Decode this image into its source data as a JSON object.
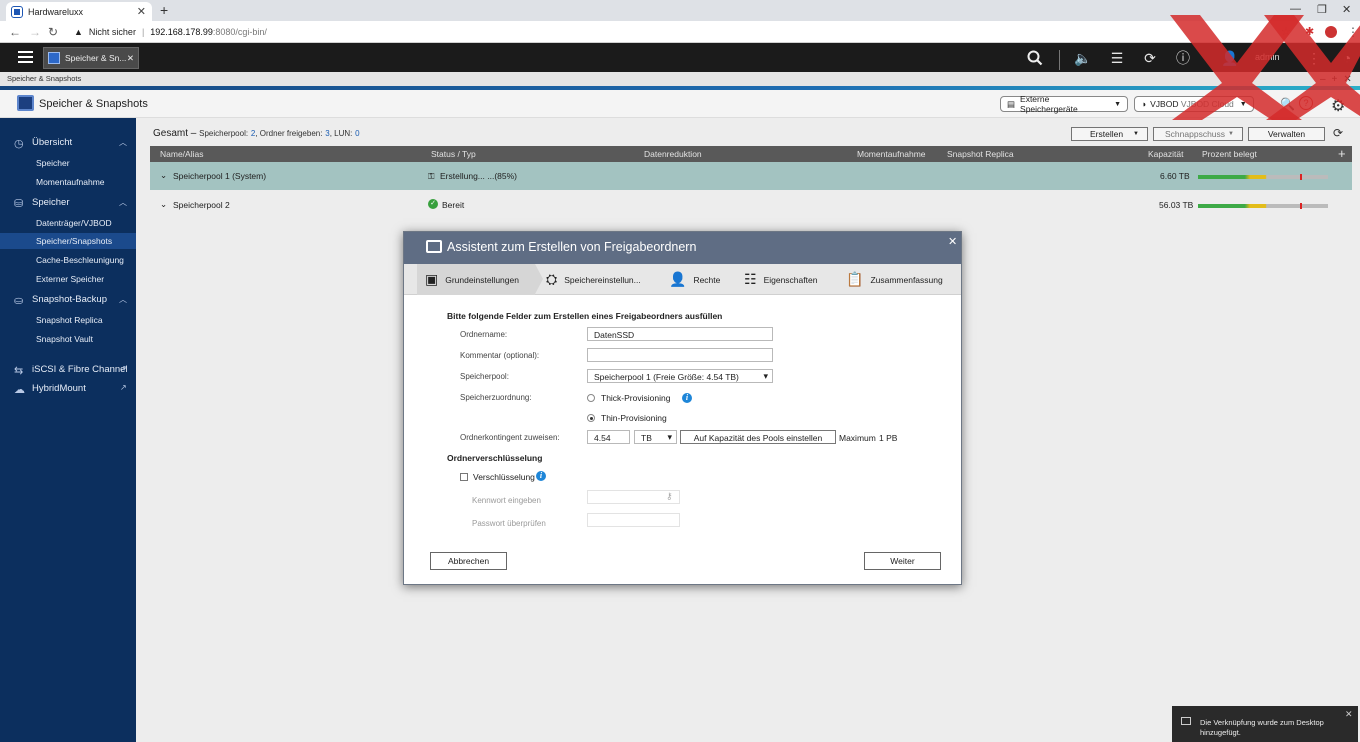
{
  "browser": {
    "tab_title": "Hardwareluxx",
    "security_label": "Nicht sicher",
    "url_host": "192.168.178.99",
    "url_path": ":8080/cgi-bin/"
  },
  "qts": {
    "app_tab": "Speicher & Sn...",
    "user": "admin",
    "strip_title": "Speicher & Snapshots"
  },
  "app": {
    "title": "Speicher & Snapshots",
    "btn_external": "Externe Speichergeräte",
    "btn_vjbod": "VJBOD",
    "btn_vjbod_cloud": "VJBOD Cloud"
  },
  "sidebar": {
    "overview": "Übersicht",
    "overview_items": [
      "Speicher",
      "Momentaufnahme"
    ],
    "storage": "Speicher",
    "storage_items": [
      "Datenträger/VJBOD",
      "Speicher/Snapshots",
      "Cache-Beschleunigung",
      "Externer Speicher"
    ],
    "snapshot_backup": "Snapshot-Backup",
    "snapshot_items": [
      "Snapshot Replica",
      "Snapshot Vault"
    ],
    "iscsi": "iSCSI & Fibre Channel",
    "hybridmount": "HybridMount"
  },
  "summary": {
    "label": "Gesamt",
    "dash": "–",
    "pool_label": "Speicherpool:",
    "pool_count": "2",
    "share_label": ", Ordner freigeben:",
    "share_count": "3",
    "lun_label": ", LUN:",
    "lun_count": "0"
  },
  "toolbar": {
    "create": "Erstellen",
    "snapshot": "Schnappschuss",
    "manage": "Verwalten"
  },
  "table": {
    "headers": [
      "Name/Alias",
      "Status / Typ",
      "Datenreduktion",
      "Momentaufnahme",
      "Snapshot Replica",
      "Kapazität",
      "Prozent belegt"
    ],
    "add": "+",
    "rows": [
      {
        "name": "Speicherpool 1 (System)",
        "status": "Erstellung... ...(85%)",
        "capacity": "6.60 TB",
        "used": 0.8
      },
      {
        "name": "Speicherpool 2",
        "status": "Bereit",
        "capacity": "56.03 TB",
        "used": 0.8
      }
    ]
  },
  "dialog": {
    "title": "Assistent zum Erstellen von Freigabeordnern",
    "steps": [
      "Grundeinstellungen",
      "Speichereinstellun...",
      "Rechte",
      "Eigenschaften",
      "Zusammenfassung"
    ],
    "intro": "Bitte folgende Felder zum Erstellen eines Freigabeordners ausfüllen",
    "folder_name_label": "Ordnername:",
    "folder_name_value": "DatenSSD",
    "comment_label": "Kommentar (optional):",
    "comment_value": "",
    "pool_label": "Speicherpool:",
    "pool_value": "Speicherpool 1 (Freie Größe: 4.54 TB)",
    "alloc_label": "Speicherzuordnung:",
    "thick": "Thick-Provisioning",
    "thin": "Thin-Provisioning",
    "quota_label": "Ordnerkontingent zuweisen:",
    "quota_value": "4.54",
    "quota_unit": "TB",
    "quota_btn": "Auf Kapazität des Pools einstellen",
    "max_label": "Maximum",
    "max_value": "1 PB",
    "enc_header": "Ordnerverschlüsselung",
    "enc_label": "Verschlüsselung",
    "pw_label": "Kennwort eingeben",
    "pw_verify_label": "Passwort überprüfen",
    "cancel": "Abbrechen",
    "next": "Weiter"
  },
  "toast": {
    "text": "Die Verknüpfung wurde zum Desktop hinzugefügt."
  },
  "colors": {
    "sidebar_bg": "#0c2f5e",
    "accent": "#1b5fb6",
    "dialog_header": "#5f6d84",
    "watermark": "#d42a2a"
  }
}
